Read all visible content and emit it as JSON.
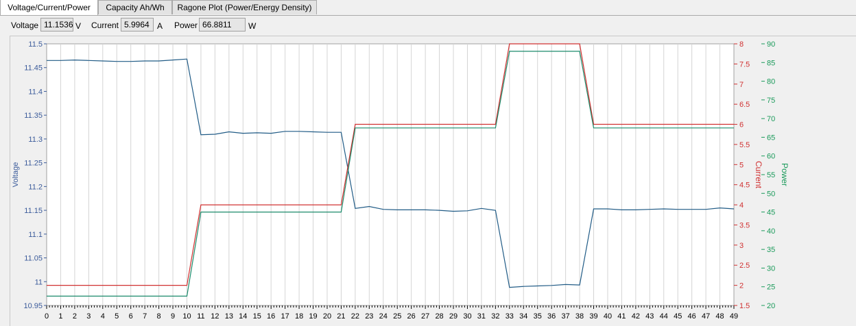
{
  "tabs": [
    {
      "label": "Voltage/Current/Power",
      "active": true
    },
    {
      "label": "Capacity Ah/Wh",
      "active": false
    },
    {
      "label": "Ragone Plot (Power/Energy Density)",
      "active": false
    }
  ],
  "readouts": {
    "voltage": {
      "label": "Voltage",
      "value": "11.1536",
      "unit": "V"
    },
    "current": {
      "label": "Current",
      "value": "5.9964",
      "unit": "A"
    },
    "power": {
      "label": "Power",
      "value": "66.8811",
      "unit": "W"
    }
  },
  "chart_data": {
    "type": "line",
    "x": [
      0,
      1,
      2,
      3,
      4,
      5,
      6,
      7,
      8,
      9,
      10,
      11,
      12,
      13,
      14,
      15,
      16,
      17,
      18,
      19,
      20,
      21,
      22,
      23,
      24,
      25,
      26,
      27,
      28,
      29,
      30,
      31,
      32,
      33,
      34,
      35,
      36,
      37,
      38,
      39,
      40,
      41,
      42,
      43,
      44,
      45,
      46,
      47,
      48,
      49
    ],
    "x_ticks": [
      "0",
      "1",
      "2",
      "3",
      "4",
      "5",
      "6",
      "7",
      "8",
      "9",
      "10",
      "11",
      "12",
      "13",
      "14",
      "15",
      "16",
      "17",
      "18",
      "19",
      "20",
      "21",
      "22",
      "23",
      "24",
      "25",
      "26",
      "27",
      "28",
      "29",
      "30",
      "31",
      "32",
      "33",
      "34",
      "35",
      "36",
      "37",
      "38",
      "39",
      "40",
      "41",
      "42",
      "43",
      "44",
      "45",
      "46",
      "47",
      "48",
      "49"
    ],
    "axes": {
      "voltage": {
        "label": "Voltage",
        "ylim": [
          10.95,
          11.5
        ],
        "ticks": [
          "11.5",
          "11.45",
          "11.4",
          "11.35",
          "11.3",
          "11.25",
          "11.2",
          "11.15",
          "11.1",
          "11.05",
          "11",
          "10.95"
        ],
        "color": "#3a5a9a"
      },
      "current": {
        "label": "Current",
        "ylim": [
          1.5,
          8
        ],
        "ticks": [
          "8",
          "7.5",
          "7",
          "6.5",
          "6",
          "5.5",
          "5",
          "4.5",
          "4",
          "3.5",
          "3",
          "2.5",
          "2",
          "1.5"
        ],
        "color": "#d03030"
      },
      "power": {
        "label": "Power",
        "ylim": [
          20,
          90
        ],
        "ticks": [
          "90",
          "85",
          "80",
          "75",
          "70",
          "65",
          "60",
          "55",
          "50",
          "45",
          "40",
          "35",
          "30",
          "25",
          "20"
        ],
        "color": "#1a9a5a"
      }
    },
    "series": [
      {
        "axis": "voltage",
        "color": "#1f5a85",
        "x": [
          0,
          1,
          2,
          3,
          4,
          5,
          6,
          7,
          8,
          9,
          10,
          11,
          12,
          13,
          14,
          15,
          16,
          17,
          18,
          19,
          20,
          21,
          22,
          23,
          24,
          25,
          26,
          27,
          28,
          29,
          30,
          31,
          32,
          33,
          34,
          35,
          36,
          37,
          38,
          39,
          40,
          41,
          42,
          43,
          44,
          45,
          46,
          47,
          48,
          49
        ],
        "values": [
          11.465,
          11.465,
          11.466,
          11.465,
          11.464,
          11.463,
          11.463,
          11.464,
          11.464,
          11.466,
          11.468,
          11.309,
          11.31,
          11.315,
          11.312,
          11.313,
          11.312,
          11.316,
          11.316,
          11.315,
          11.314,
          11.314,
          11.154,
          11.158,
          11.152,
          11.151,
          11.151,
          11.151,
          11.15,
          11.148,
          11.149,
          11.154,
          11.15,
          10.988,
          10.99,
          10.991,
          10.992,
          10.994,
          10.993,
          11.153,
          11.153,
          11.151,
          11.151,
          11.152,
          11.153,
          11.152,
          11.152,
          11.152,
          11.155,
          11.153
        ]
      },
      {
        "axis": "current",
        "color": "#d03030",
        "x": [
          0,
          10,
          11,
          21,
          22,
          32,
          33,
          38,
          39,
          49
        ],
        "values": [
          2.0,
          2.0,
          4.0,
          4.0,
          6.0,
          6.0,
          8.0,
          8.0,
          6.0,
          6.0
        ]
      },
      {
        "axis": "power",
        "color": "#1a8a6a",
        "x": [
          0,
          10,
          11,
          21,
          22,
          32,
          33,
          38,
          39,
          49
        ],
        "values": [
          22.5,
          22.5,
          45.0,
          45.0,
          67.5,
          67.5,
          88.0,
          88.0,
          67.5,
          67.5
        ]
      }
    ],
    "grid": true
  }
}
